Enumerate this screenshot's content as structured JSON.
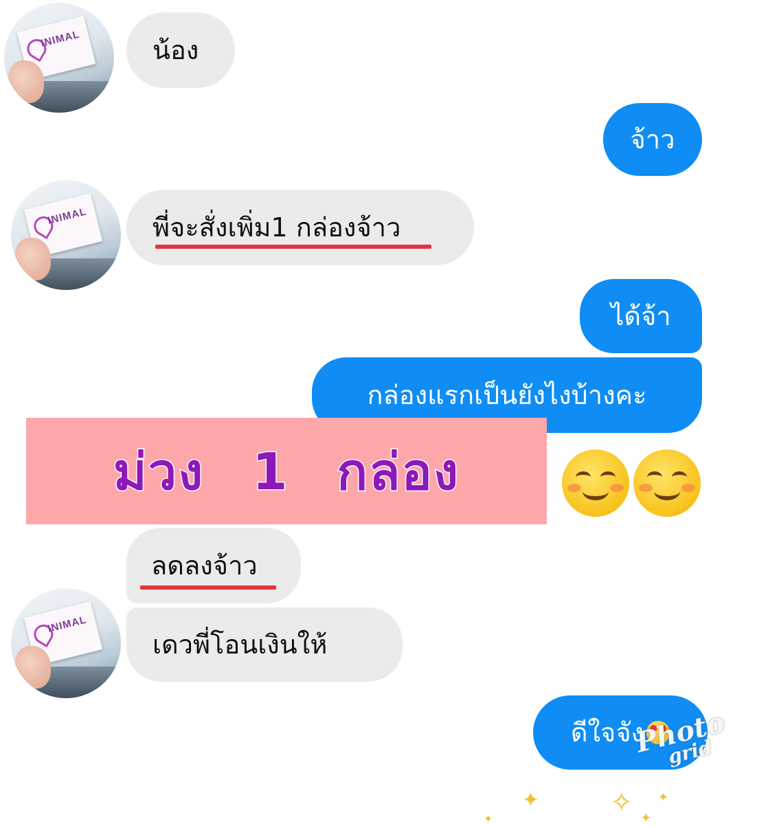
{
  "contact": {
    "avatar_text": "INIMAL"
  },
  "messages": [
    {
      "from": "contact",
      "text": "น้อง"
    },
    {
      "from": "me",
      "text": "จ้าว"
    },
    {
      "from": "contact",
      "text": "พี่จะสั่งเพิ่ม1 กล่องจ้าว"
    },
    {
      "from": "me",
      "text": "ได้จ้า"
    },
    {
      "from": "me",
      "text": "กล่องแรกเป็นยังไงบ้างคะ"
    },
    {
      "from": "contact",
      "text": "ลดลงจ้าว"
    },
    {
      "from": "contact",
      "text": "เดวพี่โอนเงินให้"
    },
    {
      "from": "me",
      "text": "ดีใจจัง"
    }
  ],
  "overlay_banner": {
    "text": "ม่วง 1 กล่อง"
  },
  "watermark": {
    "line1": "Photo",
    "line2": "grid"
  },
  "colors": {
    "sent_bubble": "#0f8df5",
    "received_bubble": "#ebebeb",
    "banner_bg": "#fda7aa",
    "banner_text": "#8e18b9",
    "underline": "#e5323e"
  }
}
